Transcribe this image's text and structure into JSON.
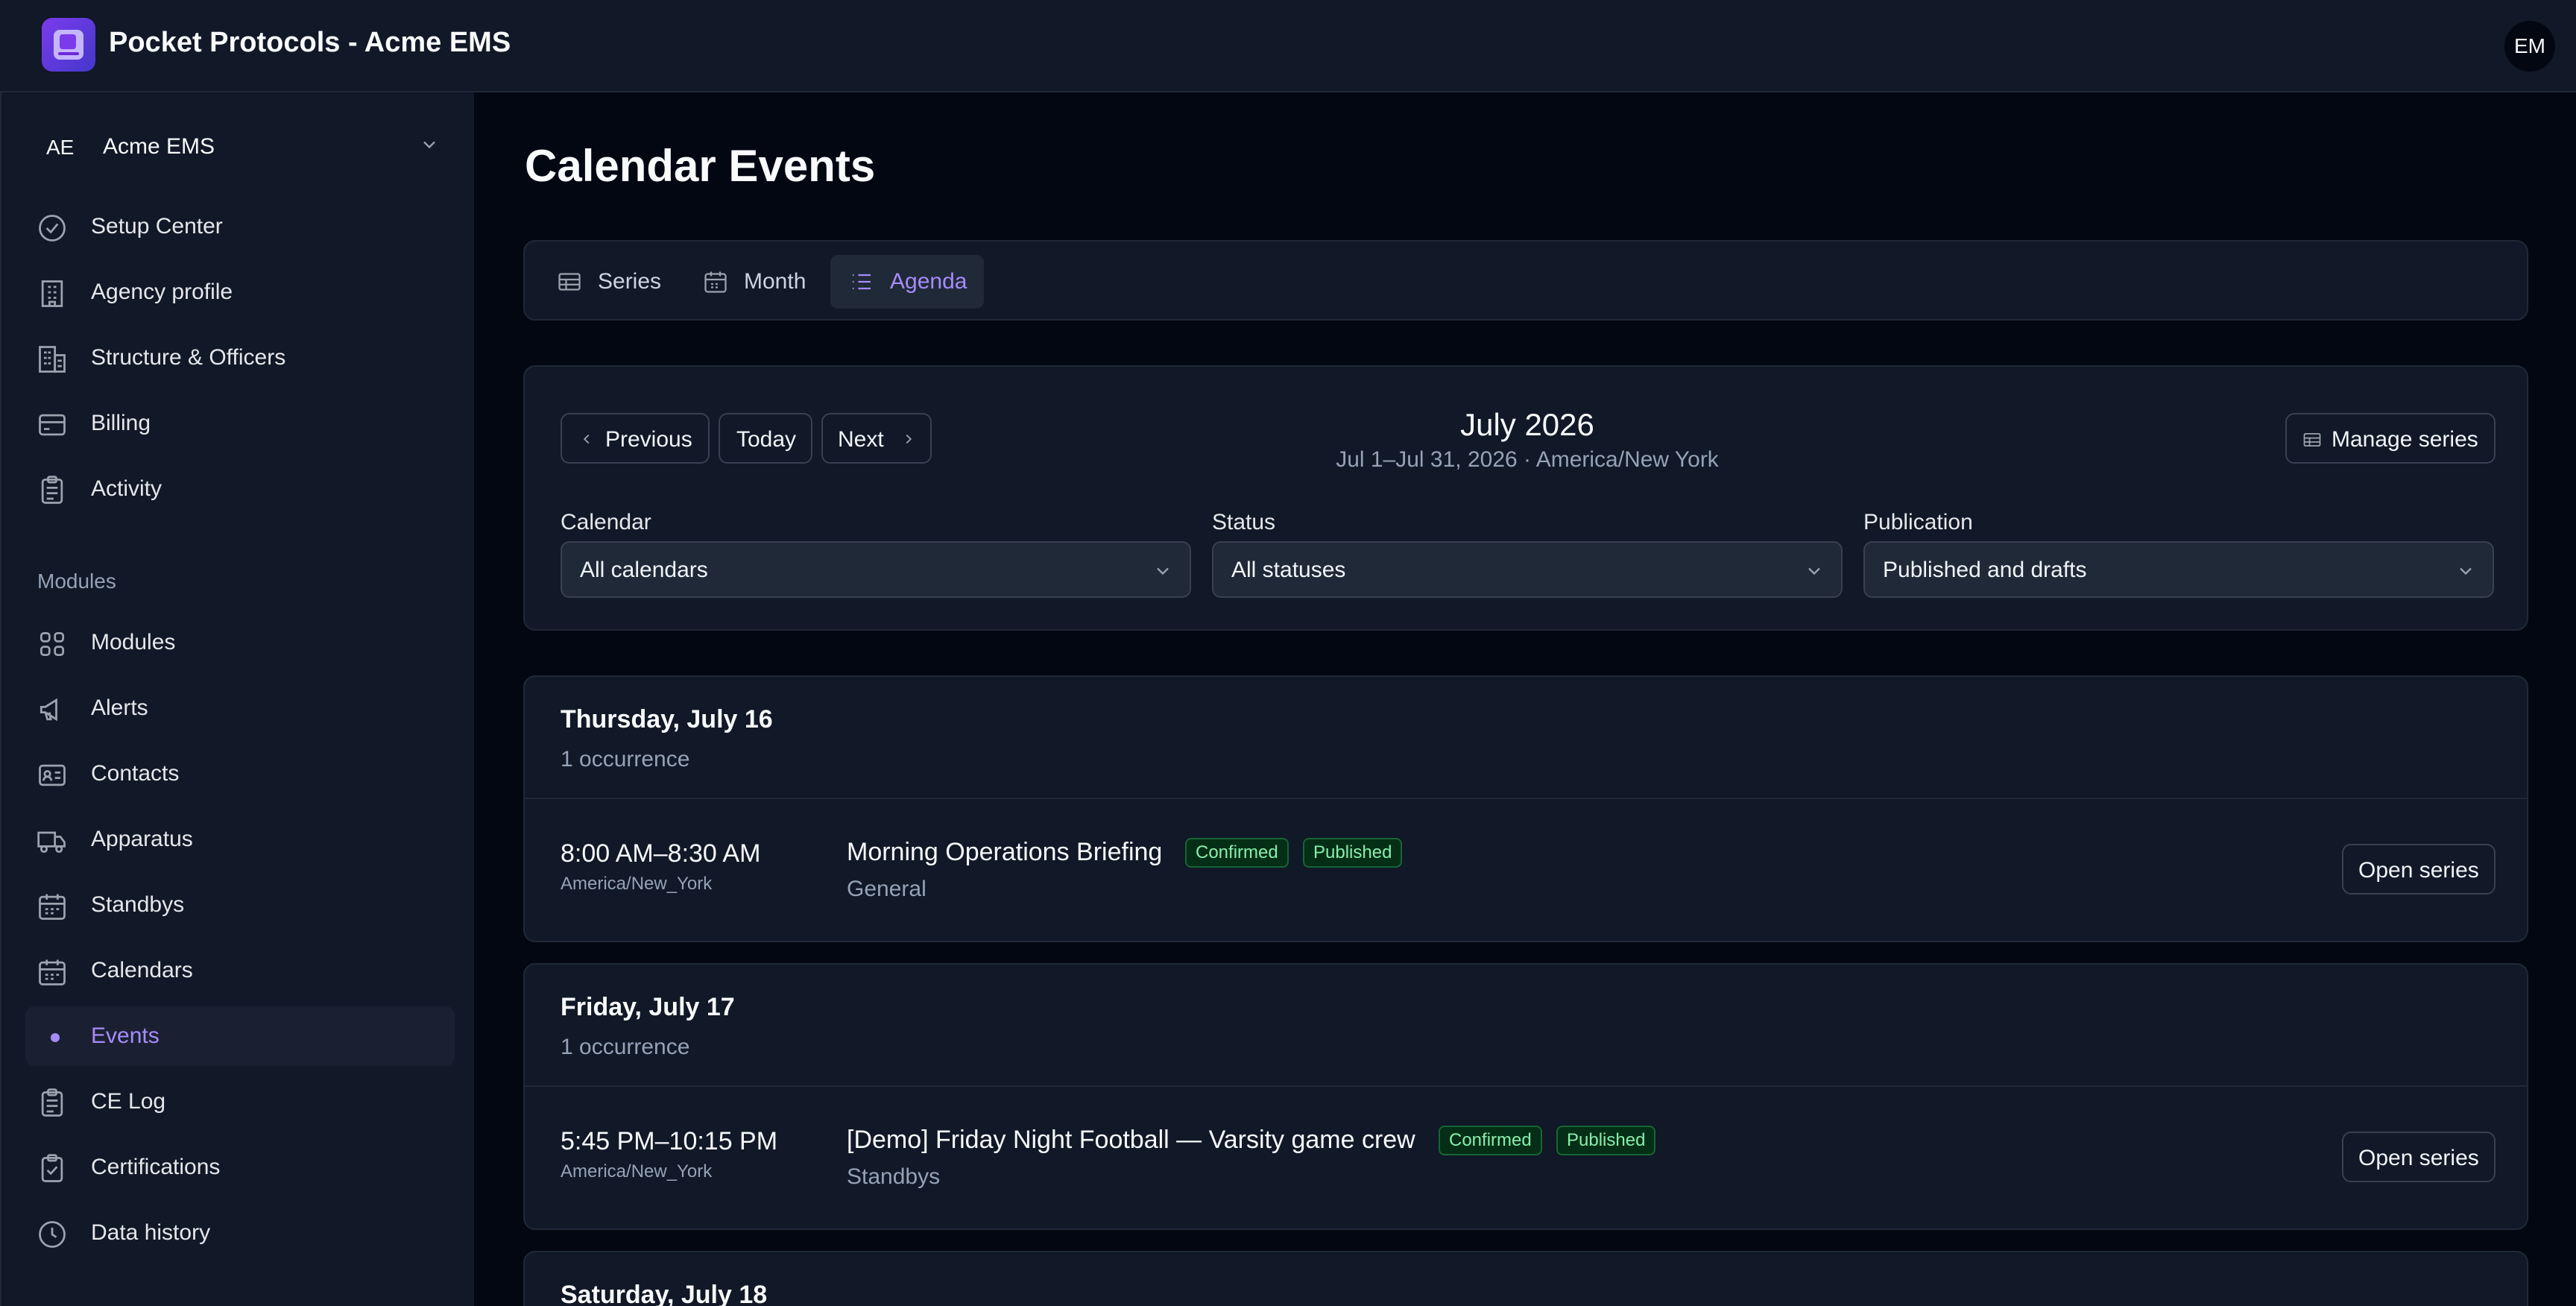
{
  "app": {
    "title": "Pocket Protocols - Acme EMS",
    "user_initials": "EM",
    "accent": "#a78bfa"
  },
  "sidebar": {
    "org": {
      "abbr": "AE",
      "name": "Acme EMS"
    },
    "items": [
      {
        "label": "Setup Center",
        "icon": "check-circle-icon"
      },
      {
        "label": "Agency profile",
        "icon": "building-icon"
      },
      {
        "label": "Structure & Officers",
        "icon": "buildings-icon"
      },
      {
        "label": "Billing",
        "icon": "credit-card-icon"
      },
      {
        "label": "Activity",
        "icon": "clipboard-icon"
      }
    ],
    "section_label": "Modules",
    "modules": [
      {
        "label": "Modules",
        "icon": "grid-icon"
      },
      {
        "label": "Alerts",
        "icon": "megaphone-icon"
      },
      {
        "label": "Contacts",
        "icon": "contact-card-icon"
      },
      {
        "label": "Apparatus",
        "icon": "truck-icon"
      },
      {
        "label": "Standbys",
        "icon": "calendar-icon"
      },
      {
        "label": "Calendars",
        "icon": "calendar-icon"
      },
      {
        "label": "Events",
        "icon": "dot-icon",
        "active": true
      },
      {
        "label": "CE Log",
        "icon": "clipboard-icon"
      },
      {
        "label": "Certifications",
        "icon": "clipboard-check-icon"
      },
      {
        "label": "Data history",
        "icon": "clock-icon"
      }
    ]
  },
  "main": {
    "title": "Calendar Events",
    "tabs": [
      {
        "label": "Series",
        "icon": "table-icon"
      },
      {
        "label": "Month",
        "icon": "calendar-icon"
      },
      {
        "label": "Agenda",
        "icon": "list-icon",
        "active": true
      }
    ],
    "nav": {
      "previous": "Previous",
      "today": "Today",
      "next": "Next",
      "manage": "Manage series"
    },
    "period": {
      "title": "July 2026",
      "subtitle": "Jul 1–Jul 31, 2026 · America/New York"
    },
    "filters": [
      {
        "label": "Calendar",
        "value": "All calendars"
      },
      {
        "label": "Status",
        "value": "All statuses"
      },
      {
        "label": "Publication",
        "value": "Published and drafts"
      }
    ],
    "days": [
      {
        "title": "Thursday, July 16",
        "count": "1 occurrence",
        "event": {
          "time": "8:00 AM–8:30 AM",
          "tz": "America/New_York",
          "title": "Morning Operations Briefing",
          "status": "Confirmed",
          "publication": "Published",
          "calendar": "General",
          "action": "Open series"
        }
      },
      {
        "title": "Friday, July 17",
        "count": "1 occurrence",
        "event": {
          "time": "5:45 PM–10:15 PM",
          "tz": "America/New_York",
          "title": "[Demo] Friday Night Football — Varsity game crew",
          "status": "Confirmed",
          "publication": "Published",
          "calendar": "Standbys",
          "action": "Open series"
        }
      },
      {
        "title": "Saturday, July 18"
      }
    ]
  }
}
